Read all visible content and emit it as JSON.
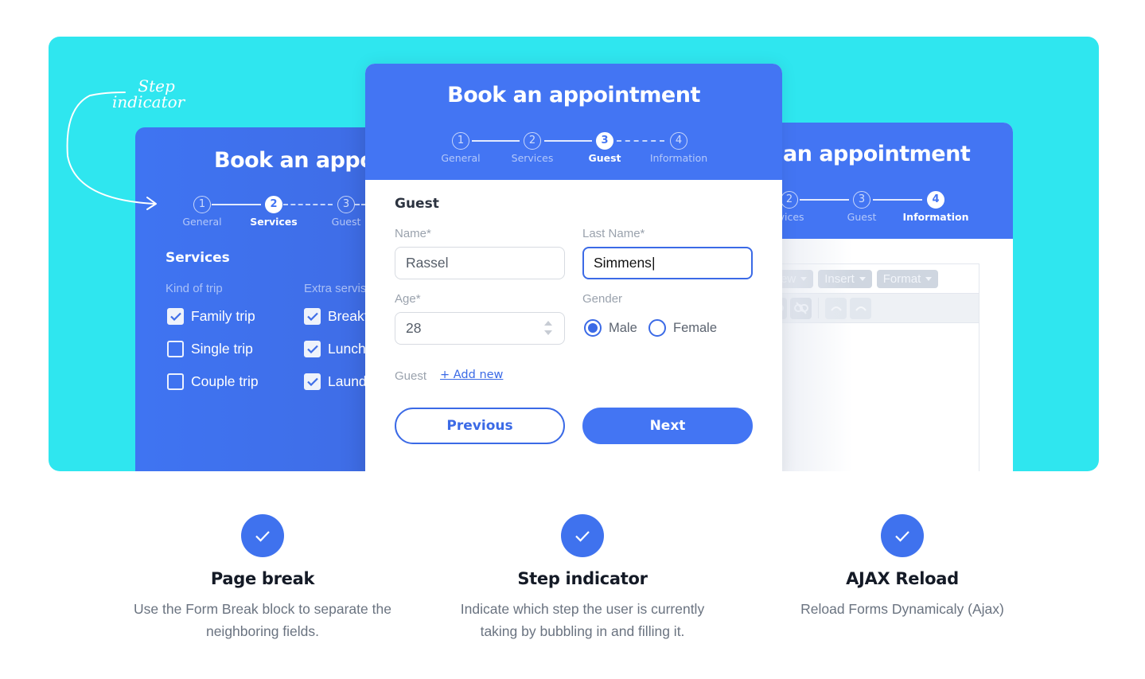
{
  "colors": {
    "hero_background": "#2fe6ef",
    "primary": "#4375f3",
    "accent_blue": "#3b6ae6",
    "text_dark": "#141a26",
    "text_muted": "#6a7380"
  },
  "annotation": {
    "line1": "Step",
    "line2": "indicator"
  },
  "card_left": {
    "title": "Book an appointment",
    "steps": [
      {
        "number": "1",
        "label": "General",
        "state": "completed"
      },
      {
        "number": "2",
        "label": "Services",
        "state": "active"
      },
      {
        "number": "3",
        "label": "Guest",
        "state": "pending"
      }
    ],
    "section_title": "Services",
    "kind_of_trip": {
      "label": "Kind of trip",
      "options": [
        {
          "label": "Family trip",
          "checked": true
        },
        {
          "label": "Single trip",
          "checked": false
        },
        {
          "label": "Couple trip",
          "checked": false
        }
      ]
    },
    "extra_services": {
      "label": "Extra servis",
      "options": [
        {
          "label": "Breakf",
          "checked": true
        },
        {
          "label": "Lunch",
          "checked": true
        },
        {
          "label": "Laund",
          "checked": true
        }
      ]
    }
  },
  "card_front": {
    "title": "Book an appointment",
    "steps": [
      {
        "number": "1",
        "label": "General",
        "state": "completed"
      },
      {
        "number": "2",
        "label": "Services",
        "state": "completed"
      },
      {
        "number": "3",
        "label": "Guest",
        "state": "active"
      },
      {
        "number": "4",
        "label": "Information",
        "state": "pending"
      }
    ],
    "section_title": "Guest",
    "fields": {
      "name": {
        "label": "Name*",
        "value": "Rassel"
      },
      "last_name": {
        "label": "Last Name*",
        "value": "Simmens"
      },
      "age": {
        "label": "Age*",
        "value": "28"
      },
      "gender": {
        "label": "Gender",
        "options": [
          {
            "label": "Male",
            "checked": true
          },
          {
            "label": "Female",
            "checked": false
          }
        ]
      }
    },
    "guest_label": "Guest",
    "add_new_label": "+ Add new",
    "previous_label": "Previous",
    "next_label": "Next"
  },
  "card_right": {
    "title": "an appointment",
    "steps": [
      {
        "number": "2",
        "label": "rvices",
        "state": "completed"
      },
      {
        "number": "3",
        "label": "Guest",
        "state": "completed"
      },
      {
        "number": "4",
        "label": "Information",
        "state": "active"
      }
    ],
    "editor_menus": [
      "View",
      "Insert",
      "Format"
    ],
    "editor_tools": [
      "link-icon",
      "unlink-icon",
      "undo-icon",
      "redo-icon"
    ]
  },
  "features": [
    {
      "icon": "check-icon",
      "title": "Page break",
      "description": "Use the Form Break block to separate the neighboring fields."
    },
    {
      "icon": "check-icon",
      "title": "Step indicator",
      "description": "Indicate which step the user is currently taking by bubbling in and filling it."
    },
    {
      "icon": "check-icon",
      "title": "AJAX Reload",
      "description": "Reload Forms Dynamicaly (Ajax)"
    }
  ]
}
